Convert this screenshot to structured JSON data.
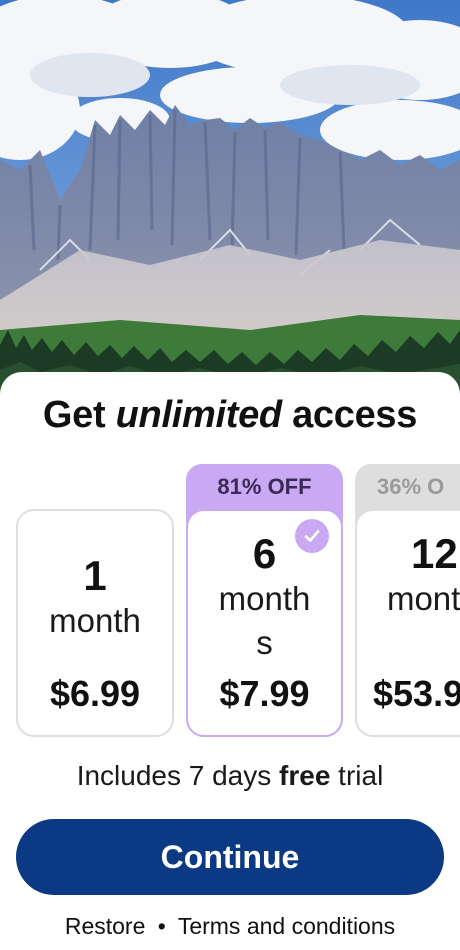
{
  "title": {
    "prefix": "Get ",
    "emphasis": "unlimited",
    "suffix": " access"
  },
  "plans": [
    {
      "number": "1",
      "unit": "month",
      "price": "$6.99",
      "badge": "",
      "selected": false
    },
    {
      "number": "6",
      "unit": "month s",
      "price": "$7.99",
      "badge": "81% OFF",
      "selected": true
    },
    {
      "number": "12",
      "unit": "mont s",
      "price": "$53.9",
      "badge": "36% O",
      "selected": false
    }
  ],
  "trial": {
    "prefix": "Includes 7 days ",
    "bold": "free",
    "suffix": " trial"
  },
  "continue_label": "Continue",
  "footer": {
    "restore": "Restore",
    "separator": "•",
    "terms": "Terms and conditions"
  },
  "colors": {
    "primary": "#0b3983",
    "selected_accent": "#c9a8f4",
    "selected_badge_text": "#3a2a55",
    "inactive_badge": "#dedede",
    "inactive_badge_text": "#9a9a9a"
  },
  "icons": {
    "selected_indicator": "checkmark-icon"
  }
}
